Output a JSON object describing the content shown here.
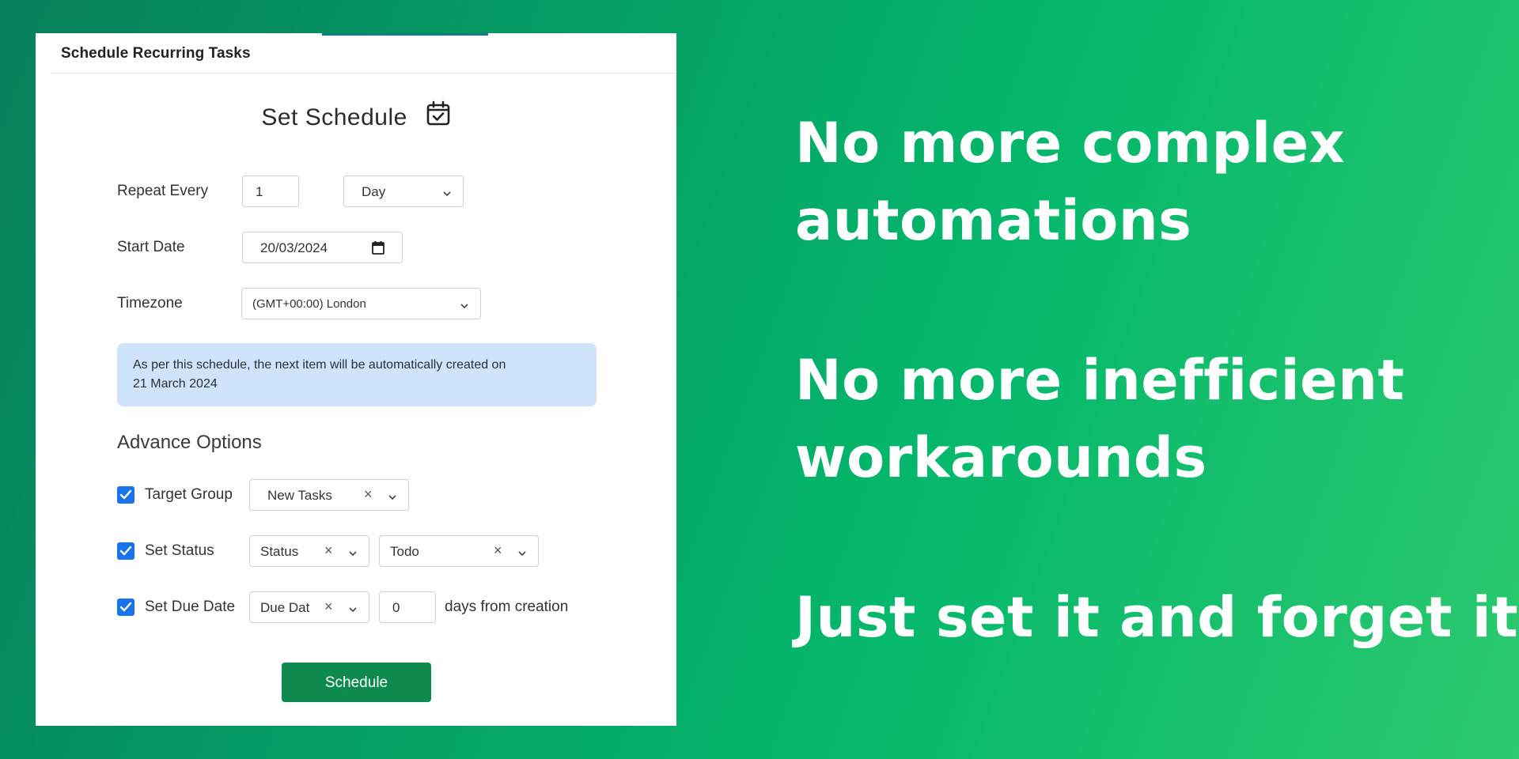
{
  "panel": {
    "header_title": "Schedule Recurring Tasks",
    "heading": "Set Schedule",
    "heading_icon": "calendar-check-icon"
  },
  "form": {
    "repeat_every": {
      "label": "Repeat Every",
      "value": "1",
      "unit": "Day"
    },
    "start_date": {
      "label": "Start Date",
      "value": "20/03/2024"
    },
    "timezone": {
      "label": "Timezone",
      "value": "(GMT+00:00) London"
    }
  },
  "info": {
    "line1": "As per this schedule, the next item will be automatically created on",
    "line2": "21 March 2024"
  },
  "advance": {
    "title": "Advance Options",
    "target_group": {
      "label": "Target Group",
      "checked": true,
      "value": "New Tasks"
    },
    "set_status": {
      "label": "Set Status",
      "checked": true,
      "field": "Status",
      "value": "Todo"
    },
    "set_due_date": {
      "label": "Set Due Date",
      "checked": true,
      "field": "Due Dat",
      "days": "0",
      "suffix": "days from creation"
    }
  },
  "schedule_button": "Schedule",
  "headlines": {
    "line1a": "No more complex",
    "line1b": "automations",
    "line2a": "No more inefficient",
    "line2b": "workarounds",
    "line3": "Just set it and forget it"
  },
  "colors": {
    "accent_blue": "#1a73e8",
    "button_green": "#0f8a4e",
    "info_bg": "#cfe4fb"
  }
}
